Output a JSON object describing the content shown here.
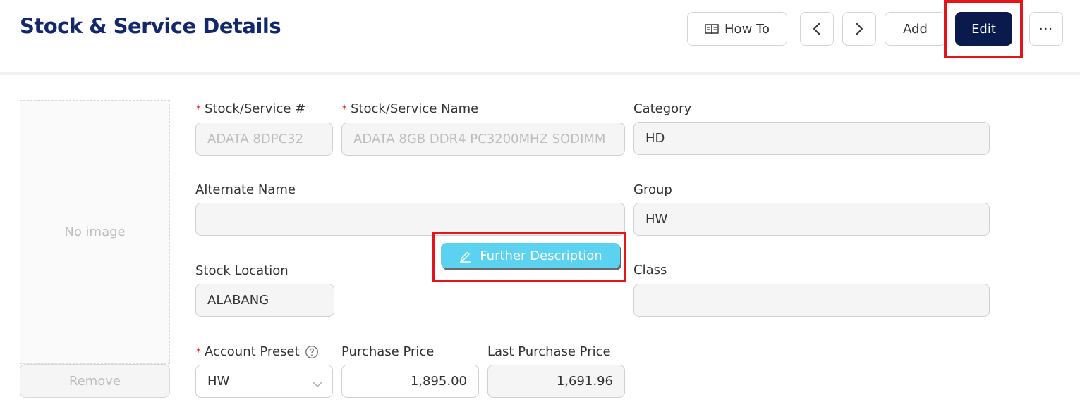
{
  "header": {
    "title": "Stock & Service Details",
    "howto_label": "How To",
    "add_label": "Add",
    "edit_label": "Edit",
    "more_label": "···"
  },
  "image_panel": {
    "placeholder": "No image",
    "remove_label": "Remove"
  },
  "form": {
    "stock_no": {
      "label": "Stock/Service #",
      "value": "ADATA 8DPC32"
    },
    "stock_name": {
      "label": "Stock/Service Name",
      "value": "ADATA 8GB DDR4 PC3200MHZ SODIMM"
    },
    "category": {
      "label": "Category",
      "value": "HD"
    },
    "alternate_name": {
      "label": "Alternate Name",
      "value": ""
    },
    "group": {
      "label": "Group",
      "value": "HW"
    },
    "further_description_label": "Further Description",
    "stock_location": {
      "label": "Stock Location",
      "value": "ALABANG"
    },
    "class": {
      "label": "Class",
      "value": ""
    },
    "account_preset": {
      "label": "Account Preset",
      "value": "HW"
    },
    "purchase_price": {
      "label": "Purchase Price",
      "value": "1,895.00"
    },
    "last_purchase_price": {
      "label": "Last Purchase Price",
      "value": "1,691.96"
    }
  },
  "colors": {
    "title": "#13286b",
    "edit_button": "#0b1a4c",
    "further_button": "#5bd3f0",
    "highlight": "#e3151b"
  }
}
